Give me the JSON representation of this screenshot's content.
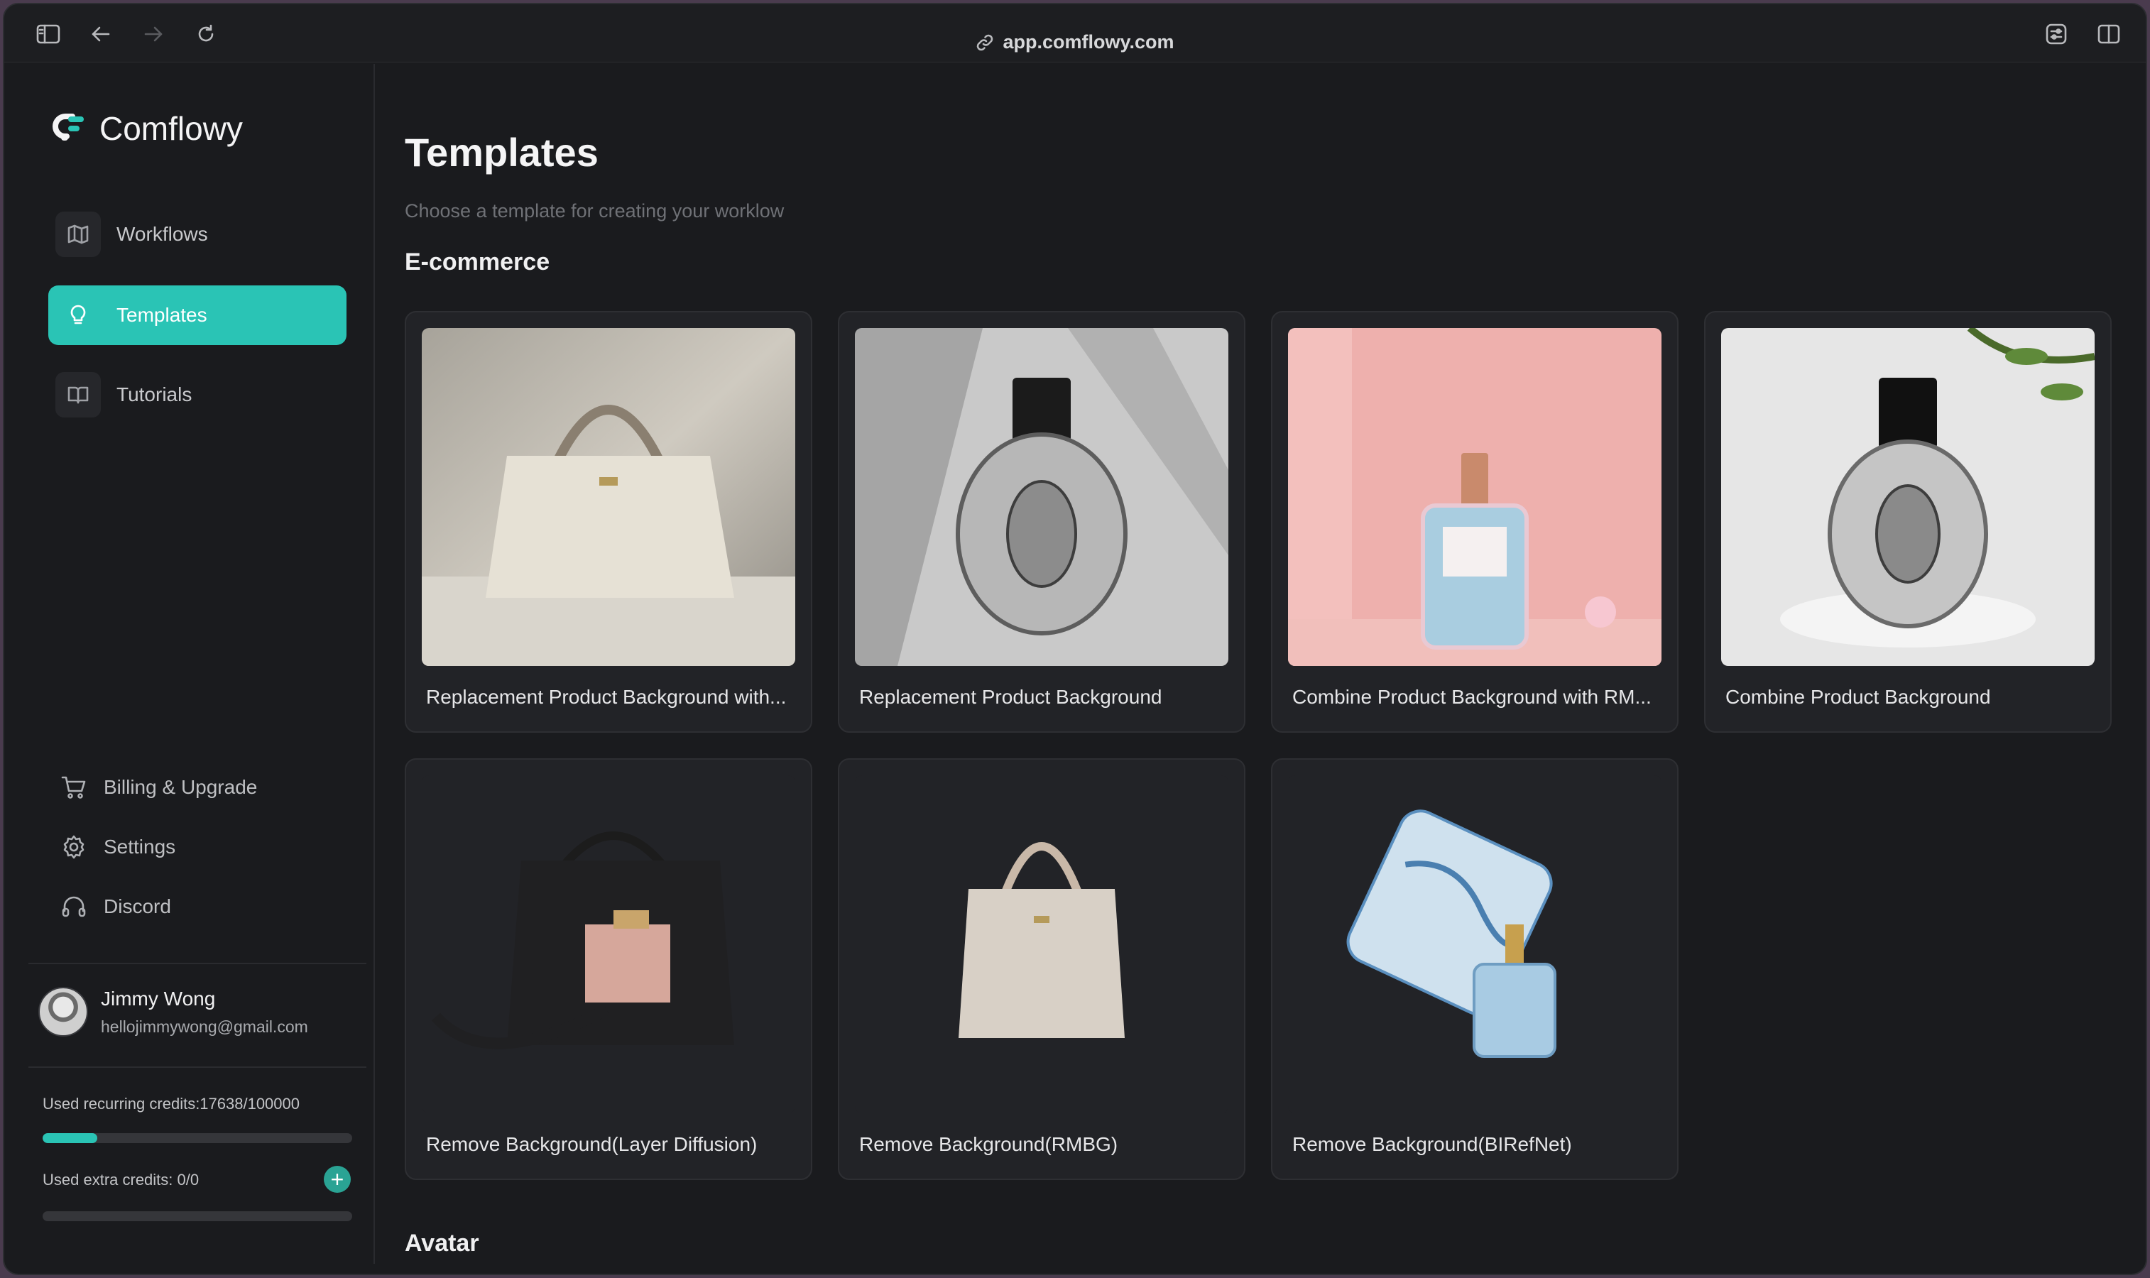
{
  "browser": {
    "url": "app.comflowy.com",
    "icons": [
      "sidebar-toggle-icon",
      "back-icon",
      "forward-icon",
      "reload-icon",
      "link-icon",
      "extension-icon",
      "split-view-icon"
    ]
  },
  "sidebar": {
    "brand": "Comflowy",
    "nav": [
      {
        "label": "Workflows",
        "icon": "map-icon",
        "active": false
      },
      {
        "label": "Templates",
        "icon": "lightbulb-icon",
        "active": true
      },
      {
        "label": "Tutorials",
        "icon": "book-icon",
        "active": false
      }
    ],
    "bottom": [
      {
        "label": "Billing & Upgrade",
        "icon": "cart-icon"
      },
      {
        "label": "Settings",
        "icon": "gear-icon"
      },
      {
        "label": "Discord",
        "icon": "headphones-icon"
      }
    ],
    "user": {
      "name": "Jimmy Wong",
      "email": "hellojimmywong@gmail.com"
    },
    "credits": {
      "recurring_label": "Used recurring credits:17638/100000",
      "recurring_fraction": 0.17638,
      "extra_label": "Used extra credits: 0/0",
      "extra_fraction": 0
    },
    "accent_color": "#2ac4b5"
  },
  "main": {
    "title": "Templates",
    "subtitle": "Choose a template for creating your worklow",
    "sections": [
      {
        "title": "E-commerce",
        "cards": [
          {
            "label": "Replacement Product Background with..."
          },
          {
            "label": "Replacement Product Background"
          },
          {
            "label": "Combine Product Background with RM..."
          },
          {
            "label": "Combine Product Background"
          },
          {
            "label": "Remove Background(Layer Diffusion)"
          },
          {
            "label": "Remove Background(RMBG)"
          },
          {
            "label": "Remove Background(BIRefNet)"
          }
        ]
      },
      {
        "title": "Avatar"
      }
    ]
  }
}
